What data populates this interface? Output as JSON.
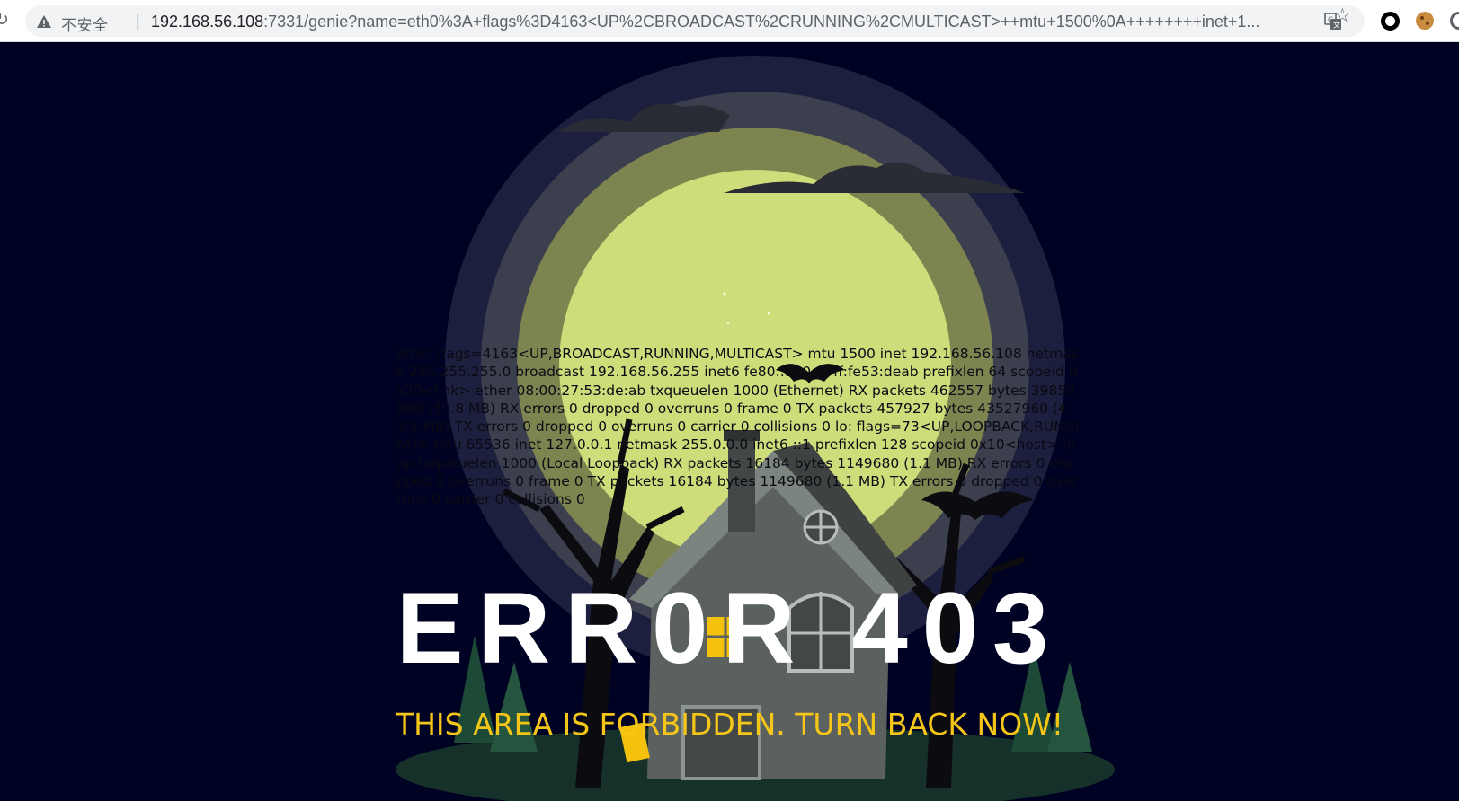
{
  "browser": {
    "security_label": "不安全",
    "url_host": "192.168.56.108",
    "url_path": ":7331/genie?name=eth0%3A+flags%3D4163<UP%2CBROADCAST%2CRUNNING%2CMULTICAST>++mtu+1500%0A++++++++inet+1..."
  },
  "page": {
    "ifconfig_output": "eth0: flags=4163<UP,BROADCAST,RUNNING,MULTICAST> mtu 1500 inet 192.168.56.108 netmask 255.255.255.0 broadcast 192.168.56.255 inet6 fe80::a00:27ff:fe53:deab prefixlen 64 scopeid 0x20<link> ether 08:00:27:53:de:ab txqueuelen 1000 (Ethernet) RX packets 462557 bytes 39850880 (39.8 MB) RX errors 0 dropped 0 overruns 0 frame 0 TX packets 457927 bytes 43527960 (43.5 MB) TX errors 0 dropped 0 overruns 0 carrier 0 collisions 0 lo: flags=73<UP,LOOPBACK,RUNNING> mtu 65536 inet 127.0.0.1 netmask 255.0.0.0 inet6 ::1 prefixlen 128 scopeid 0x10<host> loop txqueuelen 1000 (Local Loopback) RX packets 16184 bytes 1149680 (1.1 MB) RX errors 0 dropped 0 overruns 0 frame 0 TX packets 16184 bytes 1149680 (1.1 MB) TX errors 0 dropped 0 overruns 0 carrier 0 collisions 0",
    "error_title": "ERR0R 403",
    "error_subtitle": "THIS AREA IS FORBIDDEN. TURN BACK NOW!"
  },
  "colors": {
    "background": "#000223",
    "moon": "#cfdc7a",
    "title": "#ffffff",
    "subtitle": "#f5c518"
  },
  "icons": [
    "reload-icon",
    "warning-icon",
    "translate-icon",
    "star-icon",
    "extension-icon",
    "cookie-icon"
  ]
}
